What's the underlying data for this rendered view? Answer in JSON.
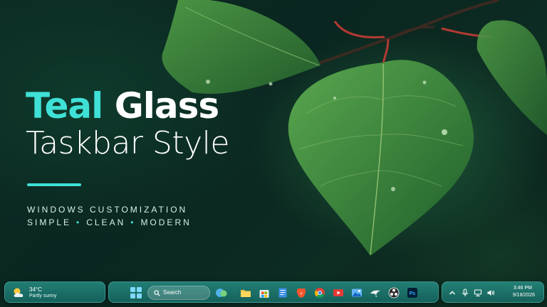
{
  "hero": {
    "title_accent": "Teal",
    "title_rest": "Glass",
    "subtitle": "Taskbar Style",
    "line1": "WINDOWS CUSTOMIZATION",
    "line2_a": "SIMPLE",
    "line2_b": "CLEAN",
    "line2_c": "MODERN",
    "separator": "•"
  },
  "colors": {
    "accent": "#3fe0d6",
    "taskbar": "#1f8a82",
    "leaf": "#3f8f3c"
  },
  "weather": {
    "icon": "partly-sunny-icon",
    "temperature": "34°C",
    "description": "Partly sunny"
  },
  "taskbar": {
    "start_icon": "windows-start-icon",
    "search_placeholder": "Search",
    "apps": [
      {
        "name": "widgets-icon"
      },
      {
        "name": "file-explorer-icon"
      },
      {
        "name": "microsoft-store-icon"
      },
      {
        "name": "notepad-icon"
      },
      {
        "name": "brave-browser-icon"
      },
      {
        "name": "chrome-browser-icon"
      },
      {
        "name": "video-player-icon"
      },
      {
        "name": "photos-icon"
      },
      {
        "name": "eagle-app-icon"
      },
      {
        "name": "obs-studio-icon"
      },
      {
        "name": "photoshop-icon"
      }
    ],
    "photoshop_label": "Ps"
  },
  "tray": {
    "icons": [
      "chevron-up-icon",
      "microphone-icon",
      "network-icon",
      "volume-icon"
    ],
    "time": "3:46 PM",
    "date": "9/18/2026"
  }
}
